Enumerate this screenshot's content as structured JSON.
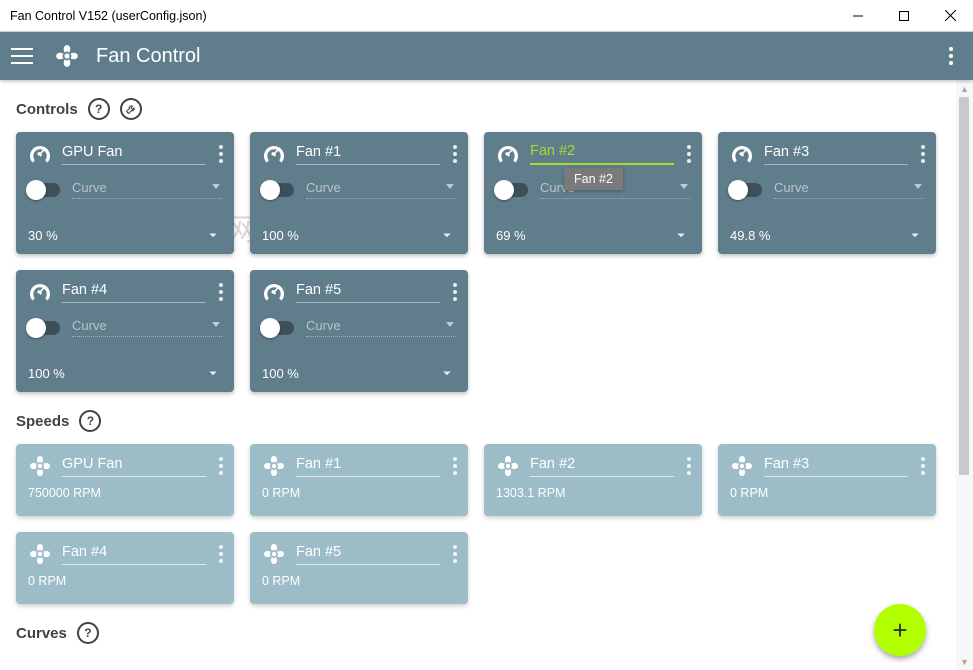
{
  "window": {
    "title": "Fan Control V152 (userConfig.json)"
  },
  "toolbar": {
    "title": "Fan Control"
  },
  "sections": {
    "controls": {
      "title": "Controls"
    },
    "speeds": {
      "title": "Speeds"
    },
    "curves": {
      "title": "Curves"
    }
  },
  "controls": [
    {
      "name": "GPU Fan",
      "curve": "Curve",
      "pct": "30 %",
      "highlight": false,
      "tooltip": null
    },
    {
      "name": "Fan #1",
      "curve": "Curve",
      "pct": "100 %",
      "highlight": false,
      "tooltip": null
    },
    {
      "name": "Fan #2",
      "curve": "Curve",
      "pct": "69 %",
      "highlight": true,
      "tooltip": "Fan #2"
    },
    {
      "name": "Fan #3",
      "curve": "Curve",
      "pct": "49.8 %",
      "highlight": false,
      "tooltip": null
    },
    {
      "name": "Fan #4",
      "curve": "Curve",
      "pct": "100 %",
      "highlight": false,
      "tooltip": null
    },
    {
      "name": "Fan #5",
      "curve": "Curve",
      "pct": "100 %",
      "highlight": false,
      "tooltip": null
    }
  ],
  "speeds": [
    {
      "name": "GPU Fan",
      "rpm": "750000 RPM"
    },
    {
      "name": "Fan #1",
      "rpm": "0 RPM"
    },
    {
      "name": "Fan #2",
      "rpm": "1303.1 RPM"
    },
    {
      "name": "Fan #3",
      "rpm": "0 RPM"
    },
    {
      "name": "Fan #4",
      "rpm": "0 RPM"
    },
    {
      "name": "Fan #5",
      "rpm": "0 RPM"
    }
  ],
  "watermark": "亿 破 姐 网 站",
  "icons": {
    "question": "?"
  },
  "fab": {
    "label": "+"
  }
}
